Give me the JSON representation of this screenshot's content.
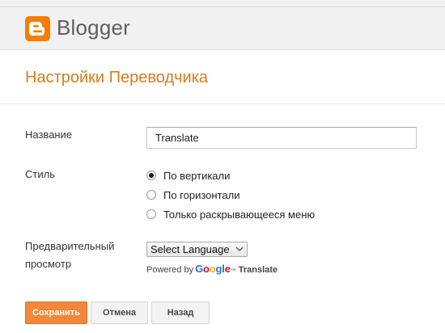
{
  "header": {
    "brand": "Blogger",
    "brand_color": "#f57d00"
  },
  "page": {
    "title": "Настройки Переводчика"
  },
  "form": {
    "name_label": "Название",
    "name_value": "Translate",
    "style_label": "Стиль",
    "style_options": [
      {
        "label": "По вертикали",
        "checked": true
      },
      {
        "label": "По горизонтали",
        "checked": false
      },
      {
        "label": "Только раскрывающееся меню",
        "checked": false
      }
    ],
    "preview_label_line1": "Предварительный",
    "preview_label_line2": "просмотр",
    "language_select": "Select Language",
    "powered_by": "Powered by",
    "google_word": "Google",
    "tm": "™",
    "translate_word": "Translate"
  },
  "buttons": {
    "save": "Сохранить",
    "cancel": "Отмена",
    "back": "Назад",
    "save_color": "#f0873a"
  }
}
